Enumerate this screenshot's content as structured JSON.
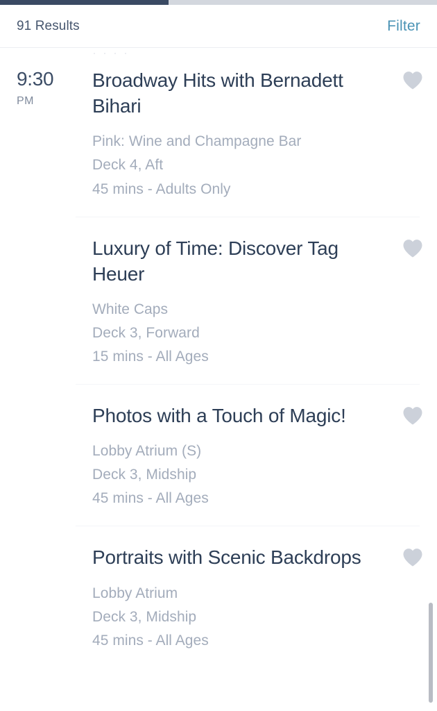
{
  "progress": {
    "percent": 38.5,
    "fill_color": "#3a4a63",
    "track_color": "#d3d7de"
  },
  "header": {
    "results_label": "91 Results",
    "filter_label": "Filter",
    "filter_color": "#4a93b5"
  },
  "colors": {
    "title": "#2d3e56",
    "meta": "#a3acbb",
    "time": "#3c4d66",
    "period": "#7f8a9c",
    "heart": "#ccd1da",
    "divider": "#f4f5f8"
  },
  "icons": {
    "favorite": "heart-icon"
  },
  "list": {
    "clipped_above": "· · · ·",
    "events": [
      {
        "time": "9:30",
        "period": "PM",
        "title": "Broadway Hits with Bernadett Bihari",
        "venue": "Pink: Wine and Champagne Bar",
        "location": "Deck 4, Aft",
        "duration": "45 mins - Adults Only",
        "favorite_icon": "heart-icon"
      },
      {
        "time": "",
        "period": "",
        "title": "Luxury of Time: Discover Tag Heuer",
        "venue": "White Caps",
        "location": "Deck 3, Forward",
        "duration": "15 mins - All Ages",
        "favorite_icon": "heart-icon"
      },
      {
        "time": "",
        "period": "",
        "title": "Photos with a Touch of Magic!",
        "venue": "Lobby Atrium (S)",
        "location": "Deck 3, Midship",
        "duration": "45 mins - All Ages",
        "favorite_icon": "heart-icon"
      },
      {
        "time": "",
        "period": "",
        "title": "Portraits with Scenic Backdrops",
        "venue": "Lobby Atrium",
        "location": "Deck 3, Midship",
        "duration": "45 mins - All Ages",
        "favorite_icon": "heart-icon"
      }
    ]
  },
  "scrollbar": {
    "thumb_color": "#b9bcc4"
  }
}
